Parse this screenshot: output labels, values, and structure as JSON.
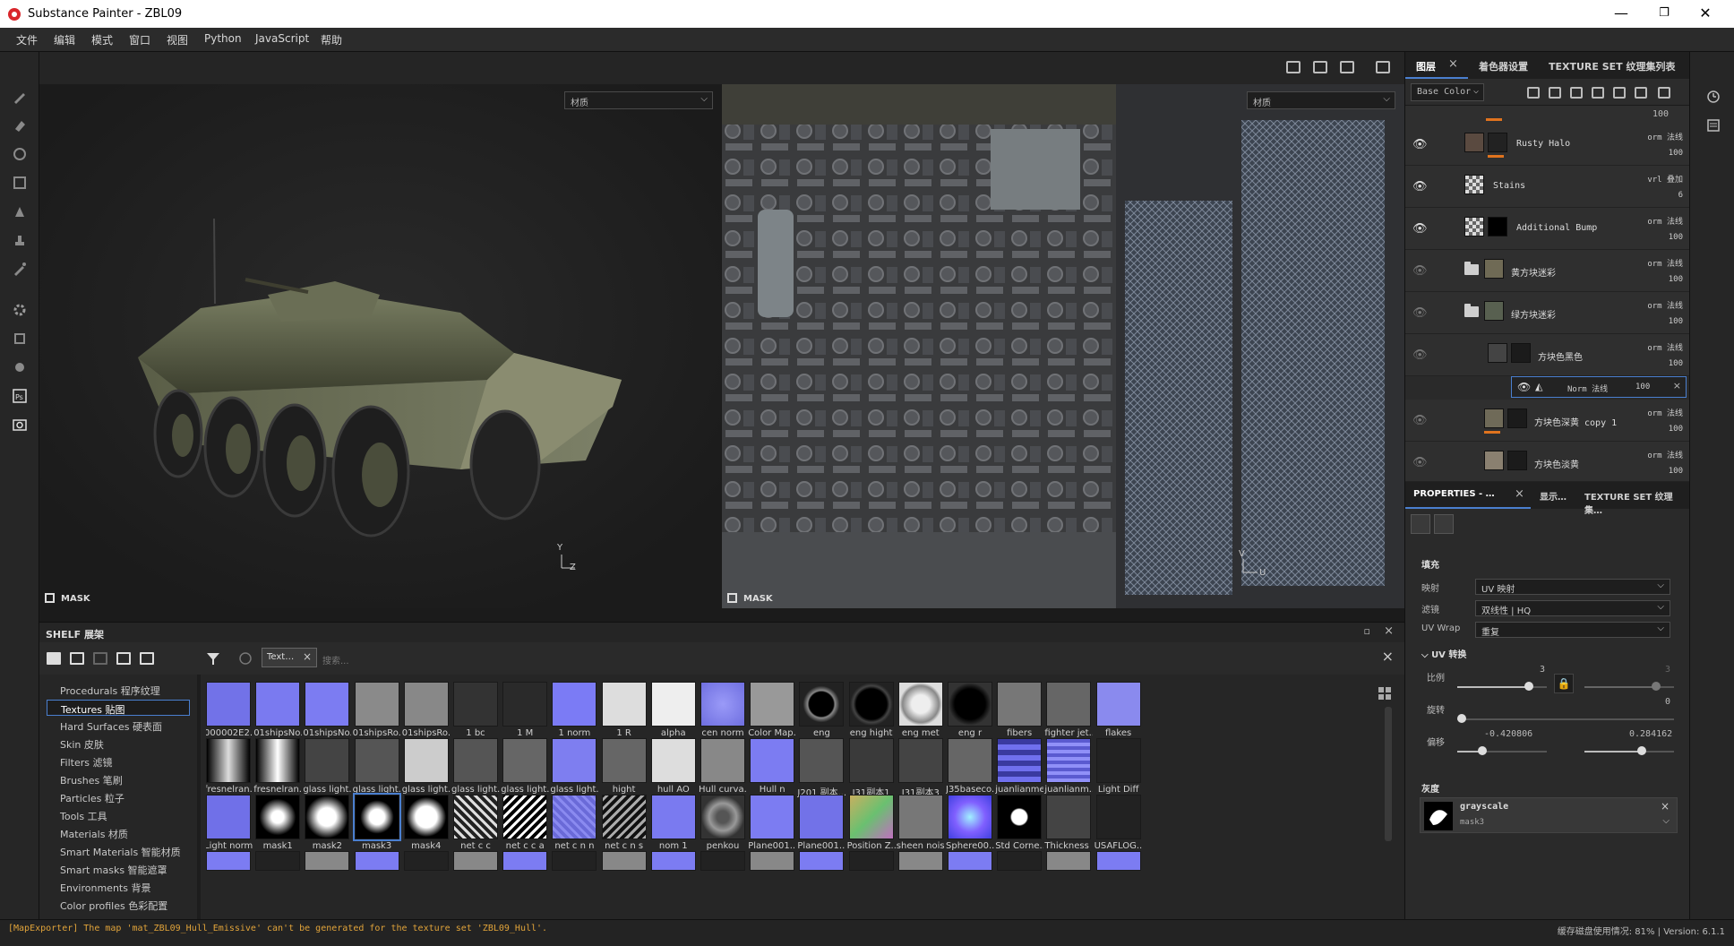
{
  "window": {
    "title": "Substance Painter - ZBL09",
    "minimize": "—",
    "maximize": "❐",
    "close": "✕"
  },
  "menu": [
    "文件",
    "编辑",
    "模式",
    "窗口",
    "视图",
    "Python",
    "JavaScript",
    "帮助"
  ],
  "viewport3d": {
    "material_select": "材质",
    "mask_label": "MASK"
  },
  "viewport2d": {
    "material_select": "材质",
    "mask_label": "MASK"
  },
  "layers_panel": {
    "tabs": [
      "图层",
      "着色器设置",
      "TEXTURE SET 纹理集列表"
    ],
    "channel": "Base Color",
    "top_opacity": "100",
    "layers": [
      {
        "name": "Rusty Halo",
        "blend": "orm 法线",
        "opacity": "100"
      },
      {
        "name": "Stains",
        "blend": "vrl 叠加",
        "opacity": "6"
      },
      {
        "name": "Additional Bump",
        "blend": "orm 法线",
        "opacity": "100"
      },
      {
        "name": "黄方块迷彩",
        "blend": "orm 法线",
        "opacity": "100"
      },
      {
        "name": "绿方块迷彩",
        "blend": "orm 法线",
        "opacity": "100"
      },
      {
        "name": "方块色黑色",
        "blend": "orm 法线",
        "opacity": "100"
      },
      {
        "name": "方块色深黄 copy 1",
        "blend": "orm 法线",
        "opacity": "100"
      },
      {
        "name": "方块色淡黄",
        "blend": "orm 法线",
        "opacity": "100"
      }
    ],
    "sublayer": {
      "blend": "Norm 法线",
      "opacity": "100"
    }
  },
  "properties_panel": {
    "tabs": [
      "PROPERTIES - …",
      "显示…",
      "TEXTURE SET 纹理集…"
    ],
    "section_fill": "填充",
    "mapping_label": "映射",
    "mapping_value": "UV 映射",
    "filter_label": "滤镜",
    "filter_value": "双线性 | HQ",
    "uvwrap_label": "UV Wrap",
    "uvwrap_value": "重复",
    "uv_transform": "UV 转换",
    "scale_label": "比例",
    "scale_value": "3",
    "scale_value2": "3",
    "rotate_label": "旋转",
    "rotate_value": "0",
    "offset_label": "偏移",
    "offset_x": "-0.420806",
    "offset_y": "0.284162",
    "section_gray": "灰度",
    "gray_name": "grayscale",
    "gray_map": "mask3"
  },
  "shelf": {
    "title": "SHELF 展架",
    "filter_tag": "Text…",
    "search_placeholder": "搜索...",
    "categories": [
      "Procedurals 程序纹理",
      "Textures 贴图",
      "Hard Surfaces 硬表面",
      "Skin 皮肤",
      "Filters 滤镜",
      "Brushes 笔刷",
      "Particles 粒子",
      "Tools 工具",
      "Materials 材质",
      "Smart Materials 智能材质",
      "Smart masks 智能遮罩",
      "Environments 背景",
      "Color profiles 色彩配置"
    ],
    "active_category": 1,
    "items": [
      "000002E2...",
      "01shipsNo...",
      "01shipsNo...",
      "01shipsRo...",
      "01shipsRo...",
      "1 bc",
      "1 M",
      "1 norm",
      "1 R",
      "alpha",
      "cen norm",
      "Color Map...",
      "eng",
      "eng hight",
      "eng met",
      "eng r",
      "fibers",
      "fighter jet...",
      "flakes",
      "fresnelran...",
      "fresnelran...",
      "glass light...",
      "glass light...",
      "glass light...",
      "glass light...",
      "glass light...",
      "glass light...",
      "hight",
      "hull AO",
      "Hull curva...",
      "Hull n",
      "J201 副本...",
      "J31副本1",
      "J31副本3",
      "J35baseco...",
      "juanlianmen",
      "juanlianm...",
      "Light Diff",
      "Light norm",
      "mask1",
      "mask2",
      "mask3",
      "mask4",
      "net c c",
      "net c c a",
      "net c n n",
      "net c n s",
      "nom 1",
      "penkou",
      "Plane001...",
      "Plane001...",
      "Position Z...",
      "sheen noise",
      "Sphere00...",
      "Std Corne...",
      "Thickness ...",
      "USAFLOG..."
    ],
    "selected_item": 41
  },
  "status": {
    "error": "[MapExporter] The map 'mat_ZBL09_Hull_Emissive' can't be generated for the texture set 'ZBL09_Hull'.",
    "info": "缓存磁盘使用情况: 81% | Version: 6.1.1"
  },
  "colors": {
    "accent": "#4a7fcf",
    "orange": "#e0731e",
    "normal_blue": "#7c7cf2"
  }
}
